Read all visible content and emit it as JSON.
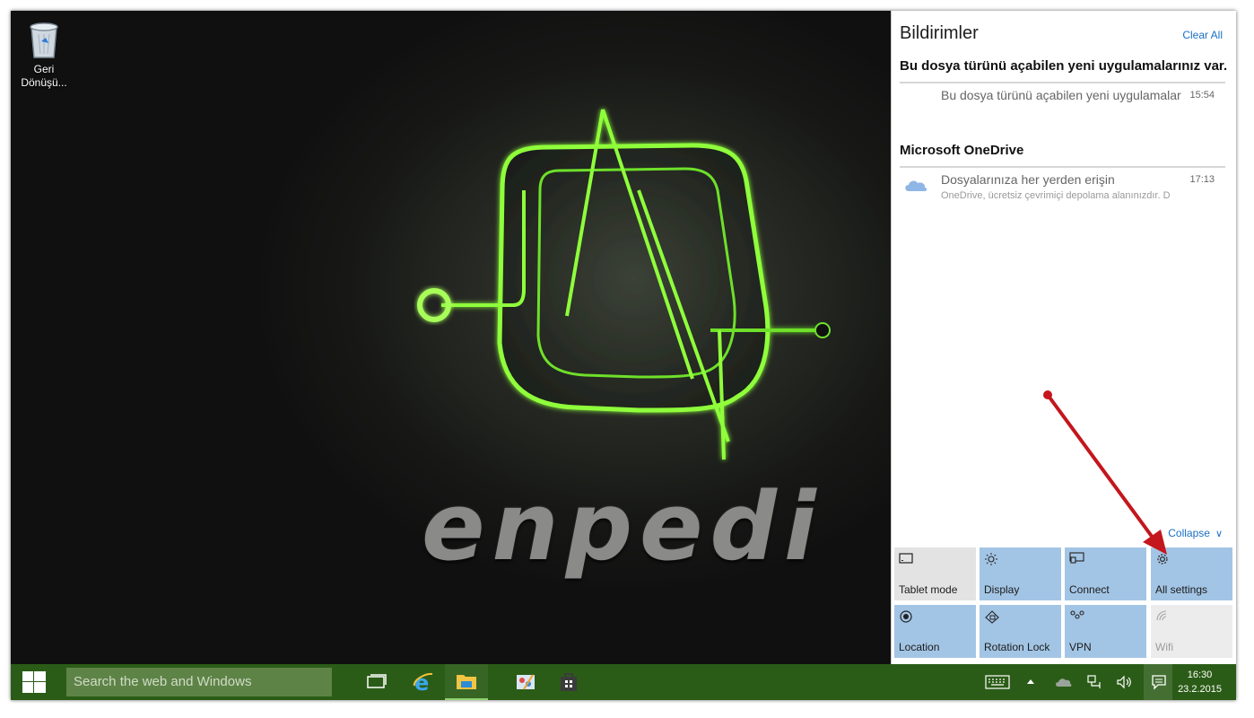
{
  "desktop": {
    "recycle_bin_label": "Geri Dönüşü...",
    "wallpaper_text": "enpedi"
  },
  "action_center": {
    "title": "Bildirimler",
    "clear_all": "Clear All",
    "groups": [
      {
        "header": "Bu dosya türünü açabilen yeni uygulamalarınız var.",
        "notifications": [
          {
            "title": "Bu dosya türünü açabilen yeni uygulamalar",
            "body": "",
            "time": "15:54"
          }
        ]
      },
      {
        "header": "Microsoft OneDrive",
        "notifications": [
          {
            "title": "Dosyalarınıza her yerden erişin",
            "body": "OneDrive, ücretsiz çevrimiçi depolama alanınızdır. D",
            "time": "17:13",
            "icon": "onedrive-cloud-icon"
          }
        ]
      }
    ],
    "collapse": "Collapse",
    "quick_actions": [
      {
        "label": "Tablet mode",
        "icon": "tablet-mode-icon",
        "state": "off"
      },
      {
        "label": "Display",
        "icon": "brightness-icon",
        "state": "on"
      },
      {
        "label": "Connect",
        "icon": "connect-icon",
        "state": "on"
      },
      {
        "label": "All settings",
        "icon": "gear-icon",
        "state": "on"
      },
      {
        "label": "Location",
        "icon": "location-icon",
        "state": "on"
      },
      {
        "label": "Rotation Lock",
        "icon": "rotation-lock-icon",
        "state": "on"
      },
      {
        "label": "VPN",
        "icon": "vpn-icon",
        "state": "on"
      },
      {
        "label": "Wifi",
        "icon": "wifi-icon",
        "state": "disabled"
      }
    ]
  },
  "taskbar": {
    "search_placeholder": "Search the web and Windows",
    "pinned": [
      "task-view-icon",
      "internet-explorer-icon",
      "file-explorer-icon",
      "paint-app-icon",
      "store-icon"
    ],
    "clock_time": "16:30",
    "clock_date": "23.2.2015"
  },
  "colors": {
    "taskbar": "#2b5c17",
    "search_box": "#5e8347",
    "tile_on": "#a3c5e5",
    "tile_off": "#e3e3e3",
    "accent_link": "#1a70c4",
    "annotation_arrow": "#c4161c",
    "logo_glow": "#8fff3a"
  }
}
